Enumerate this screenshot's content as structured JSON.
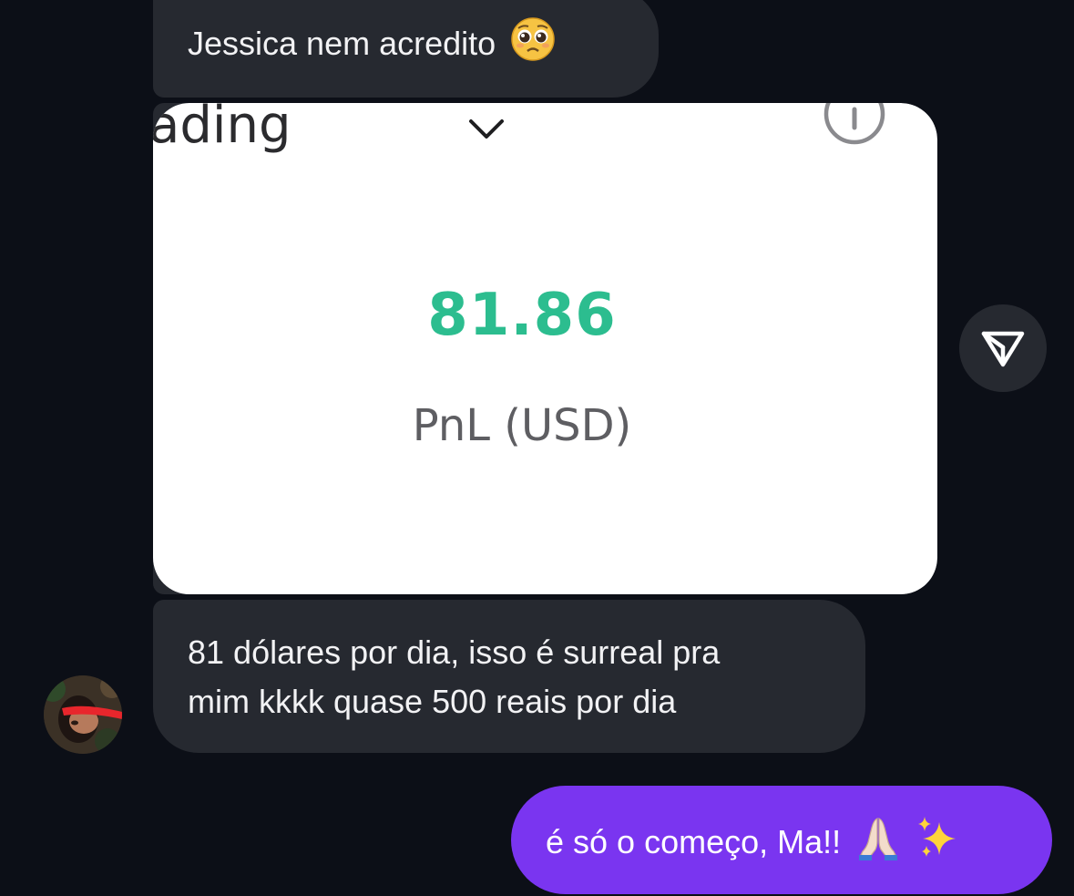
{
  "messages": [
    {
      "direction": "incoming",
      "text": "Jessica nem acredito",
      "emoji": "pleading-face"
    },
    {
      "direction": "incoming",
      "type": "image",
      "screenshot": {
        "title": "rading",
        "value": "81.86",
        "label": "PnL (USD)",
        "value_color": "#2cbd8f"
      }
    },
    {
      "direction": "incoming",
      "lines": [
        "81 dólares por dia, isso é surreal pra",
        "mim kkkk quase 500 reais por dia"
      ]
    },
    {
      "direction": "outgoing",
      "text": "é só o começo, Ma!!",
      "emojis": [
        "folded-hands",
        "sparkles"
      ]
    }
  ],
  "colors": {
    "background": "#0c0f17",
    "incoming_bubble": "#262930",
    "outgoing_bubble": "#7a35f0"
  }
}
